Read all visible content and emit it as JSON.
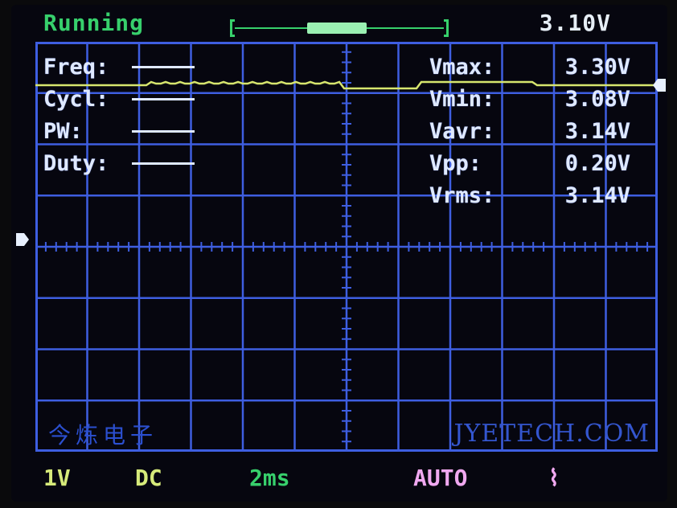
{
  "status": {
    "run_state": "Running",
    "trigger_level": "3.10V"
  },
  "measurements_left": [
    {
      "label": "Freq:",
      "value": "----"
    },
    {
      "label": "Cycl:",
      "value": "----"
    },
    {
      "label": "PW:",
      "value": "----"
    },
    {
      "label": "Duty:",
      "value": "----"
    }
  ],
  "measurements_right": [
    {
      "label": "Vmax:",
      "value": "3.30V"
    },
    {
      "label": "Vmin:",
      "value": "3.08V"
    },
    {
      "label": "Vavr:",
      "value": "3.14V"
    },
    {
      "label": "Vpp:",
      "value": "0.20V"
    },
    {
      "label": "Vrms:",
      "value": "3.14V"
    }
  ],
  "watermark": {
    "brand_cn": "今炼电子",
    "site": "JYETECH.COM"
  },
  "bottom_bar": {
    "volts_per_div": "1V",
    "coupling": "DC",
    "timebase": "2ms",
    "trigger_mode": "AUTO",
    "trigger_edge": "⌇"
  },
  "colors": {
    "grid": "#3e5ee0",
    "trace": "#d7e66e",
    "status_green": "#37d06c",
    "text_white": "#dfe9ff",
    "trigger_pink": "#f0a8f0"
  },
  "icons": {
    "ground_marker": "ground-marker-icon",
    "trigger_marker": "trigger-level-marker-icon"
  }
}
